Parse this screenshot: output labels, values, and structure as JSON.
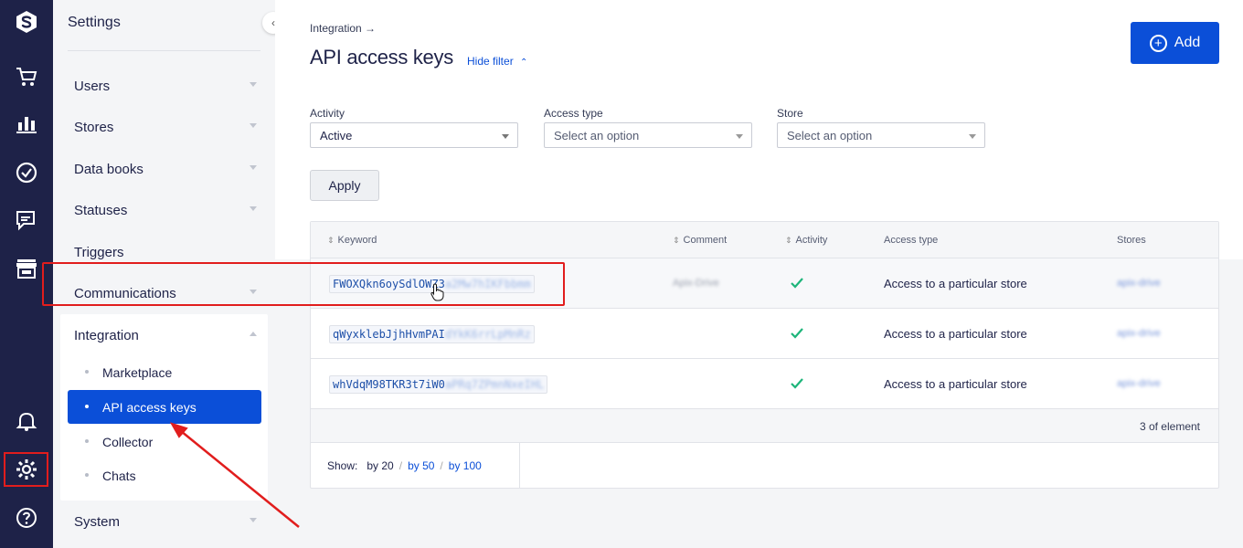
{
  "rail": {
    "items": [
      {
        "name": "logo"
      },
      {
        "name": "cart"
      },
      {
        "name": "analytics"
      },
      {
        "name": "tasks"
      },
      {
        "name": "chats"
      },
      {
        "name": "store"
      },
      {
        "name": "notifications"
      },
      {
        "name": "settings"
      },
      {
        "name": "help"
      }
    ]
  },
  "menu": {
    "title": "Settings",
    "items": [
      {
        "label": "Users"
      },
      {
        "label": "Stores"
      },
      {
        "label": "Data books"
      },
      {
        "label": "Statuses"
      },
      {
        "label": "Triggers"
      },
      {
        "label": "Communications"
      },
      {
        "label": "Integration"
      },
      {
        "label": "System"
      }
    ],
    "integration_sub": [
      {
        "label": "Marketplace"
      },
      {
        "label": "API access keys"
      },
      {
        "label": "Collector"
      },
      {
        "label": "Chats"
      }
    ]
  },
  "header": {
    "breadcrumb": "Integration →",
    "title": "API access keys",
    "hide_filter": "Hide filter",
    "add_label": "Add"
  },
  "filters": {
    "activity_label": "Activity",
    "activity_value": "Active",
    "access_label": "Access type",
    "access_placeholder": "Select an option",
    "store_label": "Store",
    "store_placeholder": "Select an option",
    "apply_label": "Apply"
  },
  "table": {
    "columns": [
      "Keyword",
      "Comment",
      "Activity",
      "Access type",
      "Stores"
    ],
    "rows": [
      {
        "key_visible": "FWOXQkn6oySdlOWZ3",
        "key_hidden": "a2Mw7hIKFbbmm",
        "comment": "Apix-Drive",
        "access": "Access to a particular store",
        "store": "apix-drive"
      },
      {
        "key_visible": "qWyxklebJjhHvmPAI",
        "key_hidden": "dYkK6rrLpMnRz",
        "comment": "",
        "access": "Access to a particular store",
        "store": "apix-drive"
      },
      {
        "key_visible": "whVdqM98TKR3t7iW0",
        "key_hidden": "aPRq7ZPmnNxeIHL",
        "comment": "",
        "access": "Access to a particular store",
        "store": "apix-drive"
      }
    ],
    "count": "3 of element",
    "show_label": "Show:",
    "show_20": "by 20",
    "show_50": "by 50",
    "show_100": "by 100"
  },
  "colors": {
    "rail": "#1e2248",
    "accent": "#0b4fd8",
    "highlight": "#e11d1d",
    "check": "#1db57a"
  }
}
